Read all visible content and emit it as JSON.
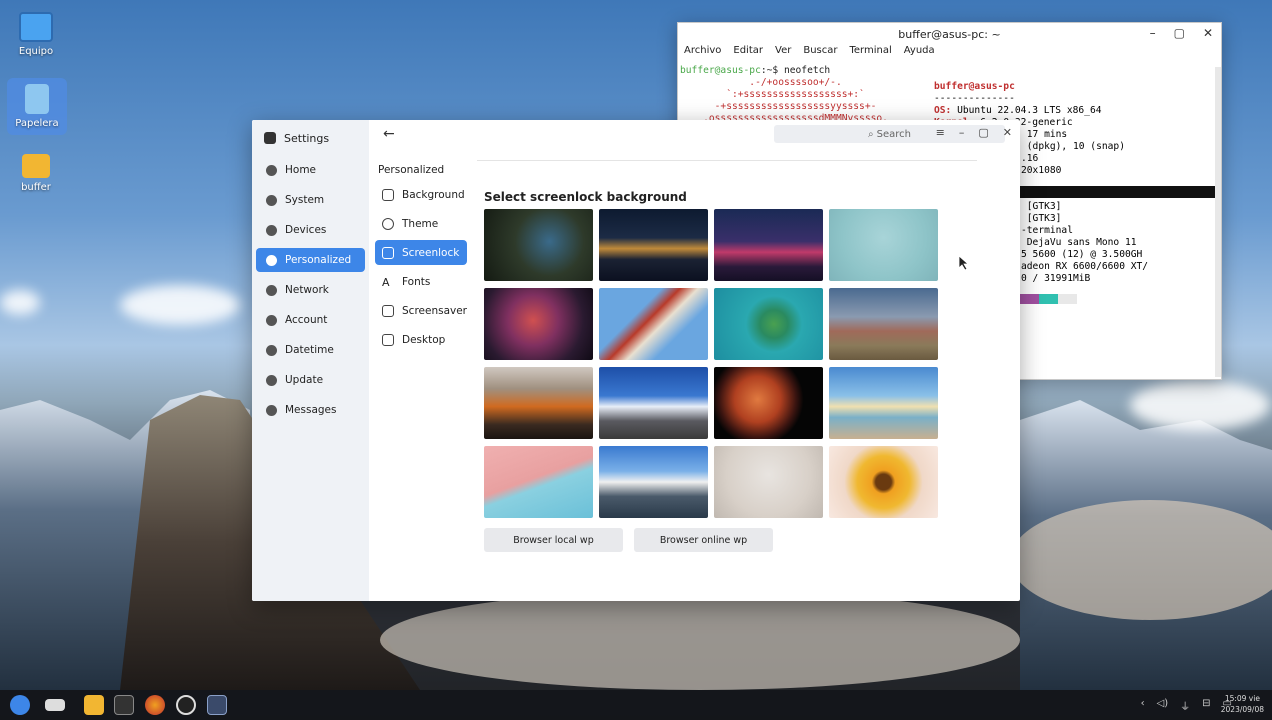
{
  "desktop": {
    "icons": [
      {
        "label": "Equipo"
      },
      {
        "label": "Papelera"
      },
      {
        "label": "buffer"
      }
    ]
  },
  "terminal": {
    "title": "buffer@asus-pc: ~",
    "menu": [
      "Archivo",
      "Editar",
      "Ver",
      "Buscar",
      "Terminal",
      "Ayuda"
    ],
    "prompt_user": "buffer@asus-pc",
    "prompt_rest": ":~$ neofetch",
    "art": [
      "            .-/+oossssoo+/-.",
      "        `:+ssssssssssssssssss+:`",
      "      -+ssssssssssssssssssyyssss+-",
      "    .ossssssssssssssssssdMMMNysssso."
    ],
    "info_user": "buffer@asus-pc",
    "info_sep": "--------------",
    "info": [
      {
        "k": "OS:",
        "v": " Ubuntu 22.04.3 LTS x86_64"
      },
      {
        "k": "Kernel:",
        "v": " 6.2.0-32-generic"
      },
      {
        "k": "",
        "v": " 17 mins"
      },
      {
        "k": "",
        "v": " (dpkg), 10 (snap)"
      },
      {
        "k": "",
        "v": ".16"
      },
      {
        "k": "",
        "v": "20x1080"
      },
      {
        "k": "",
        "v": ""
      },
      {
        "k": "",
        "v": ""
      },
      {
        "k": "",
        "v": " [GTK3]"
      },
      {
        "k": "",
        "v": " [GTK3]"
      },
      {
        "k": "",
        "v": "-terminal"
      },
      {
        "k": "",
        "v": " DejaVu sans Mono 11"
      },
      {
        "k": "",
        "v": "5 5600 (12) @ 3.500GH"
      },
      {
        "k": "",
        "v": "adeon RX 6600/6600 XT/"
      },
      {
        "k": "",
        "v": "0 / 31991MiB"
      }
    ],
    "swatch_colors": [
      "#a050a0",
      "#30c0b0",
      "#e8e8e8"
    ]
  },
  "settings": {
    "app_title": "Settings",
    "nav": [
      {
        "label": "Home"
      },
      {
        "label": "System"
      },
      {
        "label": "Devices"
      },
      {
        "label": "Personalized",
        "active": true
      },
      {
        "label": "Network"
      },
      {
        "label": "Account"
      },
      {
        "label": "Datetime"
      },
      {
        "label": "Update"
      },
      {
        "label": "Messages"
      }
    ],
    "back_icon": "←",
    "section_title": "Personalized",
    "sub_nav": [
      {
        "label": "Background"
      },
      {
        "label": "Theme"
      },
      {
        "label": "Screenlock",
        "active": true
      },
      {
        "label": "Fonts"
      },
      {
        "label": "Screensaver"
      },
      {
        "label": "Desktop"
      }
    ],
    "search_placeholder": "Search",
    "heading": "Select screenlock background",
    "wallpapers": [
      "kingfisher",
      "city-night-reflection",
      "shanghai-skyline",
      "flamingos",
      "abstract-fish",
      "geometric-building",
      "island-aerial",
      "mountain-sunset-range",
      "orange-mountains",
      "snowy-peak",
      "mars-planet",
      "beach-sunrise",
      "pink-sky-plane",
      "alpine-peak",
      "flower-vase",
      "sunflower"
    ],
    "buttons": {
      "local": "Browser local wp",
      "online": "Browser online wp"
    }
  },
  "taskbar": {
    "clock_time": "15:09 vie",
    "clock_date": "2023/09/08"
  }
}
